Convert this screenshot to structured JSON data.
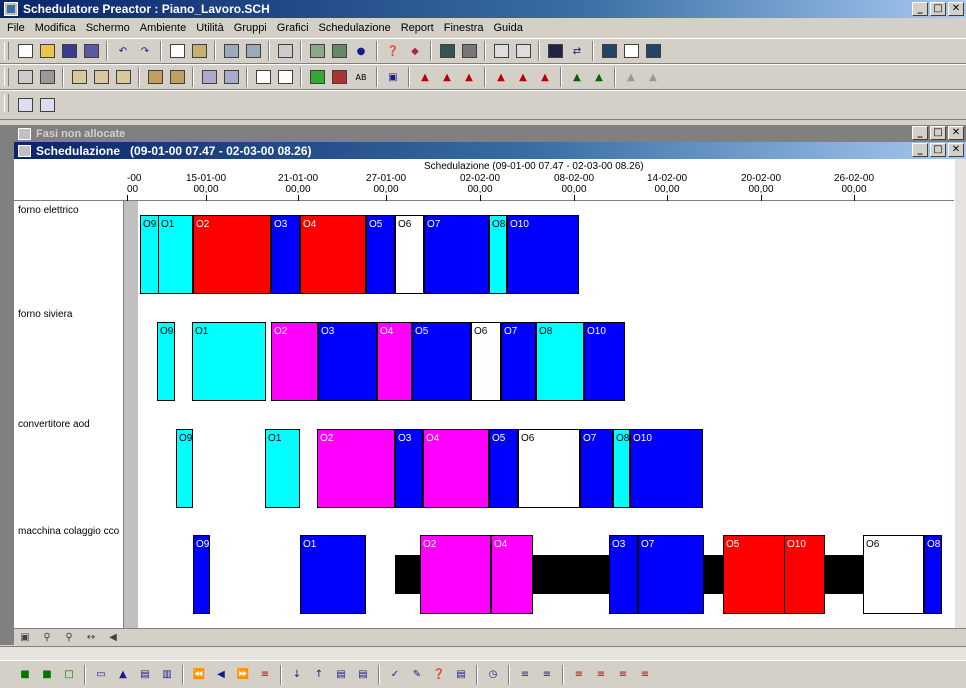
{
  "app": {
    "title": "Schedulatore Preactor : Piano_Lavoro.SCH",
    "window_buttons": [
      "_",
      "□",
      "✕"
    ]
  },
  "menu": [
    "File",
    "Modifica",
    "Schermo",
    "Ambiente",
    "Utilità",
    "Gruppi",
    "Grafici",
    "Schedulazione",
    "Report",
    "Finestra",
    "Guida"
  ],
  "unallocated_window": {
    "title": "Fasi non allocate"
  },
  "schedule_window": {
    "title": "Schedulazione",
    "range": "(09-01-00 07.47 - 02-03-00 08.26)",
    "caption": "Schedulazione  (09-01-00 07.47 - 02-03-00 08.26)",
    "ticks": [
      {
        "date": "-00",
        "time": "00"
      },
      {
        "date": "15-01-00",
        "time": "00,00"
      },
      {
        "date": "21-01-00",
        "time": "00,00"
      },
      {
        "date": "27-01-00",
        "time": "00,00"
      },
      {
        "date": "02-02-00",
        "time": "00,00"
      },
      {
        "date": "08-02-00",
        "time": "00,00"
      },
      {
        "date": "14-02-00",
        "time": "00,00"
      },
      {
        "date": "20-02-00",
        "time": "00,00"
      },
      {
        "date": "26-02-00",
        "time": "00,00"
      }
    ],
    "resources": [
      "forno elettrico",
      "forno siviera",
      "convertitore aod",
      "macchina colaggio cco"
    ]
  },
  "colors": {
    "cyan": "#00ffff",
    "red": "#ff0000",
    "blue": "#0000ff",
    "magenta": "#ff00ff",
    "white": "#ffffff",
    "black": "#000000"
  },
  "operations": [
    [
      {
        "label": "O9",
        "color": "cyan"
      },
      {
        "label": "O1",
        "color": "cyan"
      },
      {
        "label": "O2",
        "color": "red"
      },
      {
        "label": "O3",
        "color": "blue"
      },
      {
        "label": "O4",
        "color": "red"
      },
      {
        "label": "O5",
        "color": "blue"
      },
      {
        "label": "O6",
        "color": "white"
      },
      {
        "label": "O7",
        "color": "blue"
      },
      {
        "label": "O8",
        "color": "cyan"
      },
      {
        "label": "O10",
        "color": "blue"
      }
    ],
    [
      {
        "label": "O9",
        "color": "cyan"
      },
      {
        "label": "O1",
        "color": "cyan"
      },
      {
        "label": "O2",
        "color": "magenta"
      },
      {
        "label": "O3",
        "color": "blue"
      },
      {
        "label": "O4",
        "color": "magenta"
      },
      {
        "label": "O5",
        "color": "blue"
      },
      {
        "label": "O6",
        "color": "white"
      },
      {
        "label": "O7",
        "color": "blue"
      },
      {
        "label": "O8",
        "color": "cyan"
      },
      {
        "label": "O10",
        "color": "blue"
      }
    ],
    [
      {
        "label": "O9",
        "color": "cyan"
      },
      {
        "label": "O1",
        "color": "cyan"
      },
      {
        "label": "O2",
        "color": "magenta"
      },
      {
        "label": "O3",
        "color": "blue"
      },
      {
        "label": "O4",
        "color": "magenta"
      },
      {
        "label": "O5",
        "color": "blue"
      },
      {
        "label": "O6",
        "color": "white"
      },
      {
        "label": "O7",
        "color": "blue"
      },
      {
        "label": "O8",
        "color": "cyan"
      },
      {
        "label": "O10",
        "color": "blue"
      }
    ],
    [
      {
        "label": "O9",
        "color": "blue"
      },
      {
        "label": "O1",
        "color": "blue"
      },
      {
        "label": "",
        "color": "black"
      },
      {
        "label": "O2",
        "color": "magenta"
      },
      {
        "label": "O4",
        "color": "magenta"
      },
      {
        "label": "O3",
        "color": "blue"
      },
      {
        "label": "O7",
        "color": "blue"
      },
      {
        "label": "O5",
        "color": "red"
      },
      {
        "label": "O10",
        "color": "red"
      },
      {
        "label": "O6",
        "color": "white"
      },
      {
        "label": "O8",
        "color": "blue"
      }
    ]
  ]
}
